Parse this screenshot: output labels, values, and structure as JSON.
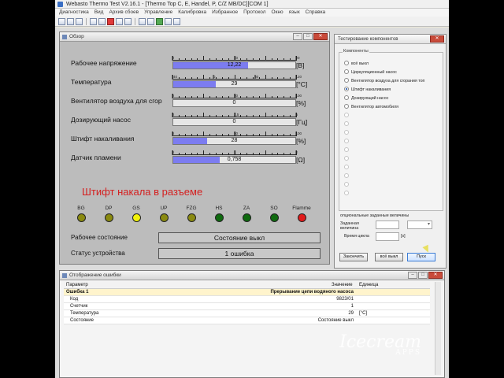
{
  "app": {
    "title": "Webasto Thermo Test V2.16.1 - [Thermo Top C, E, Handel, P, C/Z MB/DC][COM 1]"
  },
  "menu": [
    "Диагностика",
    "Вид",
    "Архив сбоев",
    "Управление",
    "Калибровка",
    "Избранное",
    "Протокол",
    "Окно",
    "язык",
    "Справка"
  ],
  "overview": {
    "title": "Обзор",
    "measurements": [
      {
        "label": "Рабочее напряжение",
        "value": "12,22",
        "fraction": 0.611,
        "unit": "[В]",
        "ticks": [
          "0",
          "10",
          "20"
        ]
      },
      {
        "label": "Температура",
        "value": "29",
        "fraction": 0.35,
        "unit": "[°C]",
        "ticks": [
          "-40",
          "0",
          "80",
          "120"
        ]
      },
      {
        "label": "Вентилятор воздуха для сгор",
        "value": "0",
        "fraction": 0.0,
        "unit": "[%]",
        "ticks": [
          "0",
          "50",
          "100"
        ]
      },
      {
        "label": "Дозирующий насос",
        "value": "0",
        "fraction": 0.0,
        "unit": "[Гц]",
        "ticks": [
          "0",
          "2,5",
          "5"
        ]
      },
      {
        "label": "Штифт накаливания",
        "value": "28",
        "fraction": 0.28,
        "unit": "[%]",
        "ticks": [
          "0",
          "50",
          "100"
        ]
      },
      {
        "label": "Датчик пламени",
        "value": "0,758",
        "fraction": 0.379,
        "unit": "[Ω]",
        "ticks": [
          "0",
          "1",
          "2"
        ]
      }
    ],
    "annotation": "Штифт накала в разъеме",
    "leds": [
      {
        "label": "BG",
        "color": "#8a8a10"
      },
      {
        "label": "DP",
        "color": "#8a8a10"
      },
      {
        "label": "GS",
        "color": "#f2f20a"
      },
      {
        "label": "UP",
        "color": "#8a8a10"
      },
      {
        "label": "FZG",
        "color": "#8a8a10"
      },
      {
        "label": "HS",
        "color": "#0f6a0f"
      },
      {
        "label": "ZA",
        "color": "#0f6a0f"
      },
      {
        "label": "SO",
        "color": "#0f6a0f"
      },
      {
        "label": "Flamme",
        "color": "#e01a1a"
      }
    ],
    "status": [
      {
        "label": "Рабочее состояние",
        "value": "Состояние выкл"
      },
      {
        "label": "Статус устройства",
        "value": "1 ошибка"
      }
    ]
  },
  "component_test": {
    "title": "Тестирование компонентов",
    "group_label": "Компоненты",
    "components": [
      {
        "label": "всё выкл",
        "selected": false
      },
      {
        "label": "Циркуляционный насос",
        "selected": false
      },
      {
        "label": "Вентилятор воздуха для сгорания топ",
        "selected": false
      },
      {
        "label": "Штифт накаливания",
        "selected": true
      },
      {
        "label": "Дозирующий насос",
        "selected": false
      },
      {
        "label": "Вентилятор автомобиля",
        "selected": false
      }
    ],
    "optional_label": "опциональные заданные величины",
    "setpoint_label": "Заданная величина",
    "cycle_label": "Время цикла",
    "cycle_unit": "[s]",
    "finish_button": "Закончить",
    "all_off_button": "всё выкл",
    "start_button": "Пуск"
  },
  "errors": {
    "title": "Отображение ошибки",
    "columns": {
      "param": "Параметр",
      "value": "Значение",
      "unit": "Единица"
    },
    "group": {
      "param": "Ошибка 1",
      "value": "Прерывание цепи водяного насоса"
    },
    "rows": [
      {
        "param": "Код",
        "value": "9823/01",
        "unit": ""
      },
      {
        "param": "Счетчик",
        "value": "1",
        "unit": ""
      },
      {
        "param": "Температура",
        "value": "29",
        "unit": "[°C]"
      },
      {
        "param": "Состояние",
        "value": "Состояние выкл",
        "unit": ""
      }
    ]
  },
  "watermark": {
    "brand": "Icecream",
    "sub": "APPS"
  }
}
